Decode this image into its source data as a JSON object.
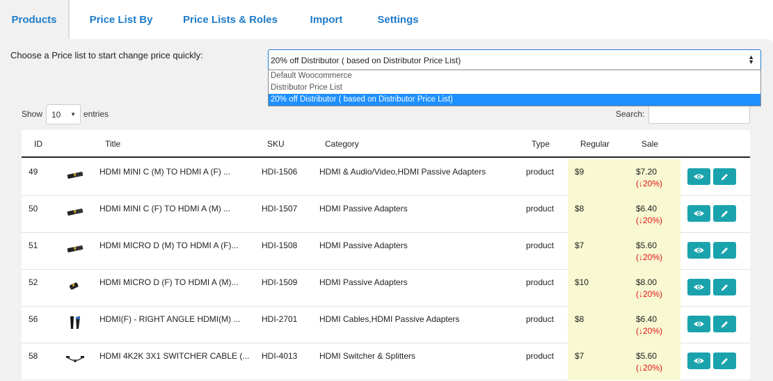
{
  "tabs": [
    {
      "label": "Products",
      "active": true
    },
    {
      "label": "Price List By",
      "active": false
    },
    {
      "label": "Price Lists & Roles",
      "active": false
    },
    {
      "label": "Import",
      "active": false
    },
    {
      "label": "Settings",
      "active": false
    }
  ],
  "price_list": {
    "label": "Choose a Price list to start change price quickly:",
    "selected": "20% off Distributor ( based on Distributor Price List)",
    "options": [
      "Default Woocommerce",
      "Distributor Price List",
      "20% off Distributor ( based on Distributor Price List)"
    ]
  },
  "length": {
    "show_label": "Show",
    "value": "10",
    "entries_label": "entries"
  },
  "search": {
    "label": "Search:"
  },
  "table": {
    "headers": {
      "id": "ID",
      "title": "Title",
      "sku": "SKU",
      "category": "Category",
      "type": "Type",
      "regular": "Regular",
      "sale": "Sale"
    },
    "rows": [
      {
        "id": "49",
        "title": "HDMI MINI C (M) TO HDMI A (F) ...",
        "sku": "HDI-1506",
        "category": "HDMI & Audio/Video,HDMI Passive Adapters",
        "type": "product",
        "regular": "$9",
        "sale": "$7.20",
        "discount": "(↓20%)",
        "thumb": "adapter-thumbnail"
      },
      {
        "id": "50",
        "title": "HDMI MINI C (F) TO HDMI A (M) ...",
        "sku": "HDI-1507",
        "category": "HDMI Passive Adapters",
        "type": "product",
        "regular": "$8",
        "sale": "$6.40",
        "discount": "(↓20%)",
        "thumb": "adapter-thumbnail"
      },
      {
        "id": "51",
        "title": "HDMI MICRO D (M) TO HDMI A (F)...",
        "sku": "HDI-1508",
        "category": "HDMI Passive Adapters",
        "type": "product",
        "regular": "$7",
        "sale": "$5.60",
        "discount": "(↓20%)",
        "thumb": "adapter-thumbnail"
      },
      {
        "id": "52",
        "title": "HDMI MICRO D (F) TO HDMI A (M)...",
        "sku": "HDI-1509",
        "category": "HDMI Passive Adapters",
        "type": "product",
        "regular": "$10",
        "sale": "$8.00",
        "discount": "(↓20%)",
        "thumb": "adapter-thumbnail"
      },
      {
        "id": "56",
        "title": "HDMI(F) - RIGHT ANGLE HDMI(M) ...",
        "sku": "HDI-2701",
        "category": "HDMI Cables,HDMI Passive Adapters",
        "type": "product",
        "regular": "$8",
        "sale": "$6.40",
        "discount": "(↓20%)",
        "thumb": "right-angle-thumbnail"
      },
      {
        "id": "58",
        "title": "HDMI 4K2K 3X1 SWITCHER CABLE (...",
        "sku": "HDI-4013",
        "category": "HDMI Switcher & Splitters",
        "type": "product",
        "regular": "$7",
        "sale": "$5.60",
        "discount": "(↓20%)",
        "thumb": "cable-thumbnail"
      }
    ]
  },
  "icons": {
    "view": "eye-icon",
    "edit": "pencil-icon"
  },
  "colors": {
    "accent": "#1e7bc8",
    "action_button": "#1aa3ad",
    "highlight": "#f8f8d2",
    "discount": "#e01010",
    "selected_option": "#1e90ff"
  }
}
